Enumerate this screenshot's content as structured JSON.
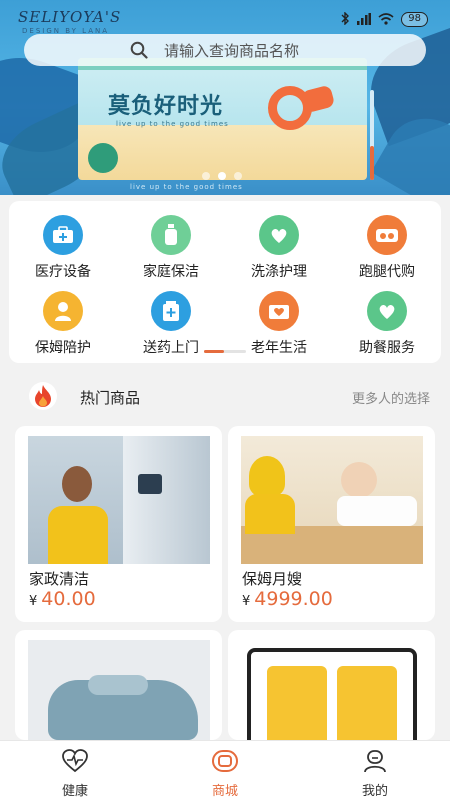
{
  "status": {
    "brand": "SELIYOYA'S",
    "brand_sub": "DESIGN BY LANA",
    "battery": "98"
  },
  "search": {
    "placeholder": "请输入查询商品名称"
  },
  "banner": {
    "title": "莫负好时光",
    "subtitle": "live up to the good times",
    "caption": "live up to the good times",
    "slide_count": 3,
    "active_slide": 1
  },
  "categories": [
    {
      "label": "医疗设备",
      "icon": "medical-kit-icon",
      "color": "#2d9fe0"
    },
    {
      "label": "家庭保洁",
      "icon": "cleaning-bottle-icon",
      "color": "#6fcf97"
    },
    {
      "label": "洗涤护理",
      "icon": "laundry-care-icon",
      "color": "#5bc68a"
    },
    {
      "label": "跑腿代购",
      "icon": "errand-icon",
      "color": "#f07c3a"
    },
    {
      "label": "保姆陪护",
      "icon": "nanny-care-icon",
      "color": "#f5b431"
    },
    {
      "label": "送药上门",
      "icon": "medicine-delivery-icon",
      "color": "#2d9fe0"
    },
    {
      "label": "老年生活",
      "icon": "elderly-life-icon",
      "color": "#f07c3a"
    },
    {
      "label": "助餐服务",
      "icon": "meal-service-icon",
      "color": "#5bc68a"
    }
  ],
  "hot": {
    "title": "热门商品",
    "more": "更多人的选择",
    "products": [
      {
        "name": "家政清洁",
        "currency": "¥",
        "price": "40.00"
      },
      {
        "name": "保姆月嫂",
        "currency": "¥",
        "price": "4999.00"
      },
      {
        "name": "",
        "currency": "",
        "price": ""
      },
      {
        "name": "",
        "currency": "",
        "price": ""
      }
    ]
  },
  "tabbar": {
    "items": [
      {
        "label": "健康",
        "icon": "heart-pulse-icon"
      },
      {
        "label": "商城",
        "icon": "shop-icon"
      },
      {
        "label": "我的",
        "icon": "profile-icon"
      }
    ],
    "active": 1
  },
  "colors": {
    "accent": "#e56b3d",
    "hero_blue": "#3d9fd6"
  }
}
